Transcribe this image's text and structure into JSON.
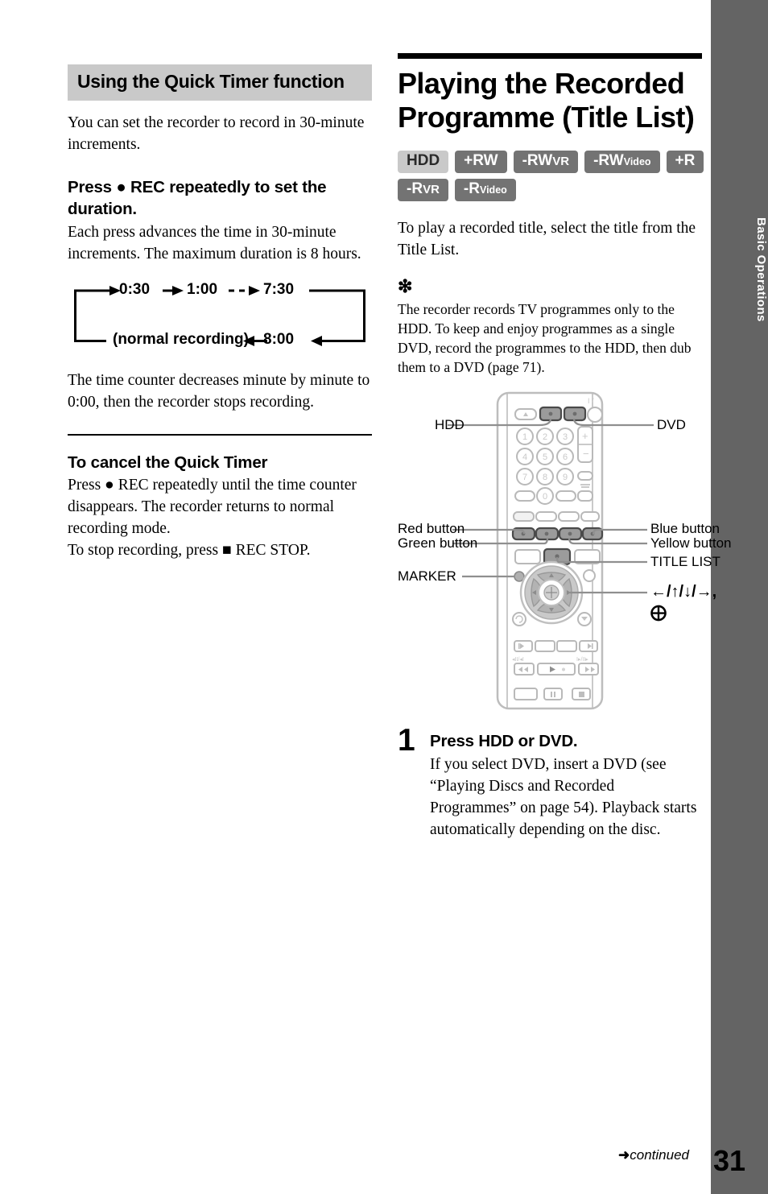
{
  "chapter_tab": {
    "label": "Basic Operations"
  },
  "left": {
    "section_heading": "Using the Quick Timer function",
    "intro": "You can set the recorder to record in 30-minute increments.",
    "press_heading": "Press ● REC repeatedly to set the duration.",
    "press_body": "Each press advances the time in 30-minute increments. The maximum duration is 8 hours.",
    "cycle": {
      "step1": "0:30",
      "step2": "1:00",
      "step3": "7:30",
      "step4": "8:00",
      "step5": "(normal recording)"
    },
    "after_cycle": "The time counter decreases minute by minute to 0:00, then the recorder stops recording.",
    "cancel_heading": "To cancel the Quick Timer",
    "cancel_body": "Press ● REC repeatedly until the time counter disappears. The recorder returns to normal recording mode.",
    "cancel_body2": "To stop recording, press ■ REC STOP."
  },
  "right": {
    "title": "Playing the Recorded Programme (Title List)",
    "badges_row1": [
      {
        "text": "HDD",
        "style": "hdd"
      },
      {
        "text": "+RW",
        "style": "dark"
      },
      {
        "text": "-RW",
        "suffix": "VR",
        "suffix_size": "md",
        "style": "dark"
      },
      {
        "text": "-RW",
        "suffix": "Video",
        "suffix_size": "sm",
        "style": "dark"
      },
      {
        "text": "+R",
        "style": "dark"
      }
    ],
    "badges_row2": [
      {
        "text": "-R",
        "suffix": "VR",
        "suffix_size": "md",
        "style": "dark"
      },
      {
        "text": "-R",
        "suffix": "Video",
        "suffix_size": "sm",
        "style": "dark"
      }
    ],
    "intro": "To play a recorded title, select the title from the Title List.",
    "note_symbol": "❇",
    "note": "The recorder records TV programmes only to the HDD. To keep and enjoy programmes as a single DVD, record the programmes to the HDD, then dub them to a DVD (page 71).",
    "remote_labels": {
      "hdd": "HDD",
      "dvd": "DVD",
      "red_button": "Red button",
      "green_button": "Green button",
      "blue_button": "Blue button",
      "yellow_button": "Yellow button",
      "marker": "MARKER",
      "title_list": "TITLE LIST",
      "arrows": "←/↑/↓/→,",
      "enter": "⨁"
    },
    "step1": {
      "number": "1",
      "title": "Press HDD or DVD.",
      "text": "If you select DVD, insert a DVD (see “Playing Discs and Recorded Programmes” on page 54). Playback starts automatically depending on the disc."
    }
  },
  "footer": {
    "continued": "continued",
    "continued_arrow": "➜",
    "page_number": "31"
  },
  "colors": {
    "tab_gray": "#646464",
    "section_bar_gray": "#c9c9c9",
    "badge_dark": "#737373",
    "badge_light": "#c9c9c9"
  }
}
